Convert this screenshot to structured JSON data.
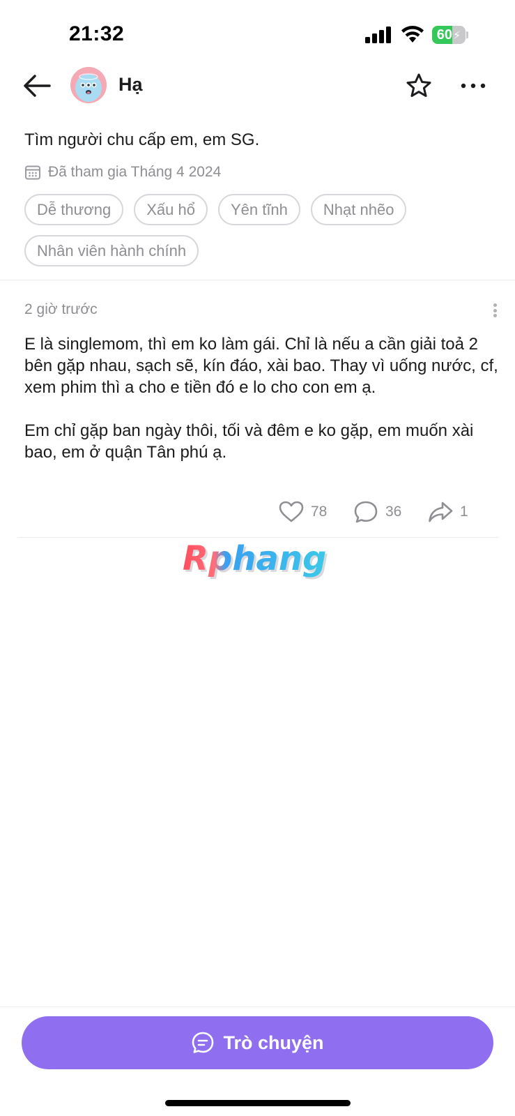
{
  "status_bar": {
    "time": "21:32",
    "battery_level": "60",
    "battery_fraction": 0.6,
    "battery_color": "#34c759",
    "icons": [
      "signal-icon",
      "wifi-icon",
      "battery-icon",
      "charging-bolt-icon"
    ]
  },
  "header": {
    "back_icon": "arrow-left-icon",
    "name": "Hạ",
    "star_icon": "star-icon",
    "more_icon": "ellipsis-icon"
  },
  "profile": {
    "bio": "Tìm người chu cấp em, em SG.",
    "joined_icon": "calendar-icon",
    "joined": "Đã tham gia Tháng 4 2024",
    "tags": [
      "Dễ thương",
      "Xấu hổ",
      "Yên tĩnh",
      "Nhạt nhẽo",
      "Nhân viên hành chính"
    ]
  },
  "post": {
    "time": "2 giờ trước",
    "paragraphs": [
      "E là singlemom, thì em ko làm gái. Chỉ là nếu a cần giải toả 2 bên gặp nhau, sạch sẽ, kín đáo, xài bao. Thay vì uống nước, cf, xem phim thì a cho e tiền đó e lo cho con em ạ.",
      "Em chỉ gặp ban ngày thôi, tối và đêm e ko gặp, em muốn xài bao, em ở quận Tân phú ạ."
    ],
    "likes": "78",
    "comments": "36",
    "shares": "1"
  },
  "watermark": {
    "text": "Rphang"
  },
  "chat_button": {
    "label": "Trò chuyện",
    "icon": "chat-bubble-icon",
    "color": "#8f6ef0"
  }
}
